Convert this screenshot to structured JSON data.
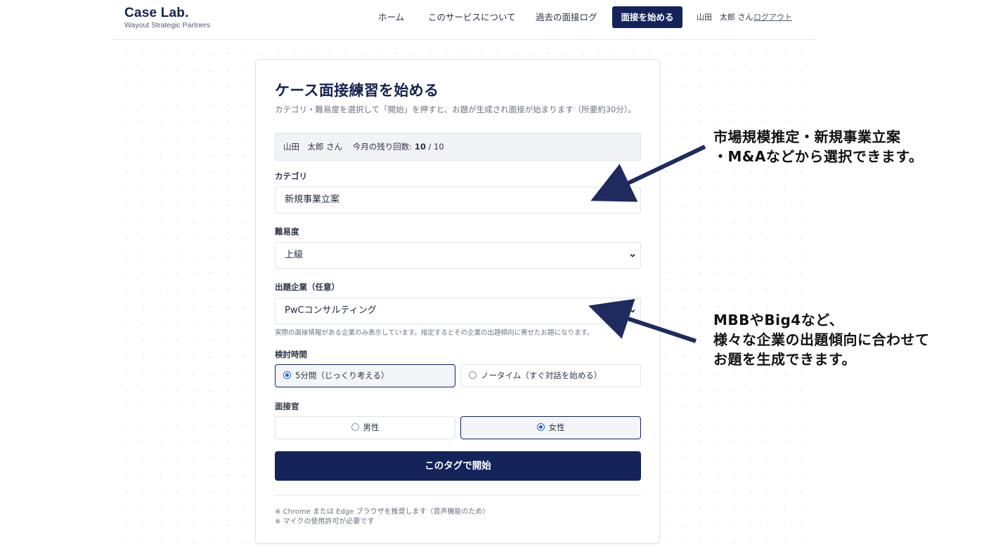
{
  "brand": {
    "name": "Case Lab.",
    "tagline": "Wayout Strategic Partners"
  },
  "nav": {
    "home": "ホーム",
    "about": "このサービスについて",
    "log": "過去の面接ログ",
    "start": "面接を始める",
    "user": "山田　太郎 さん",
    "logout": "ログアウト"
  },
  "form": {
    "title": "ケース面接練習を始める",
    "subtitle": "カテゴリ・難易度を選択して「開始」を押すと、お題が生成され面接が始まります（所要約30分）。",
    "quota": {
      "user": "山田　太郎 さん",
      "label": "今月の残り回数:",
      "remaining": "10",
      "total": "/ 10"
    },
    "category": {
      "label": "カテゴリ",
      "value": "新規事業立案"
    },
    "difficulty": {
      "label": "難易度",
      "value": "上級"
    },
    "company": {
      "label": "出題企業（任意）",
      "value": "PwCコンサルティング",
      "hint": "実際の面接情報がある企業のみ表示しています。指定するとその企業の出題傾向に寄せたお題になります。"
    },
    "think_time": {
      "label": "検討時間",
      "options": [
        {
          "label": "5分間（じっくり考える）",
          "selected": true
        },
        {
          "label": "ノータイム（すぐ対話を始める）",
          "selected": false
        }
      ]
    },
    "interviewer": {
      "label": "面接官",
      "options": [
        {
          "label": "男性",
          "selected": false
        },
        {
          "label": "女性",
          "selected": true
        }
      ]
    },
    "submit": "このタグで開始",
    "notes": [
      "※ Chrome または Edge ブラウザを推奨します（音声機能のため）",
      "※ マイクの使用許可が必要です"
    ]
  },
  "annotations": {
    "top": [
      "市場規模推定・新規事業立案",
      "・M&Aなどから選択できます。"
    ],
    "bottom": [
      "MBBやBig4など、",
      "様々な企業の出題傾向に合わせて",
      "お題を生成できます。"
    ]
  },
  "colors": {
    "brand": "#14245a",
    "radio": "#1f5bd6",
    "arrow": "#1f2a5e"
  }
}
